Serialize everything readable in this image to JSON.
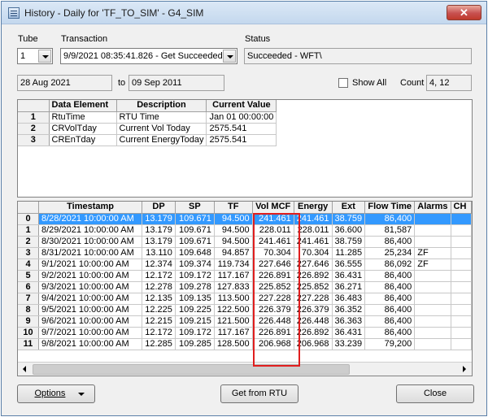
{
  "window": {
    "title": "History - Daily for 'TF_TO_SIM' - G4_SIM",
    "close_glyph": "✕"
  },
  "tube": {
    "label": "Tube",
    "value": "1"
  },
  "transaction": {
    "label": "Transaction",
    "value": "9/9/2021 08:35:41.826 - Get Succeeded"
  },
  "status": {
    "label": "Status",
    "value": "Succeeded - WFT\\"
  },
  "date_range": {
    "from": "28 Aug 2021",
    "to_label": "to",
    "to": "09 Sep 2011"
  },
  "show_all": {
    "label": "Show All",
    "checked": false
  },
  "count": {
    "label": "Count",
    "value": "4, 12"
  },
  "elements_table": {
    "headers": [
      "Data Element",
      "Description",
      "Current Value"
    ],
    "rows": [
      [
        "1",
        "RtuTime",
        "RTU Time",
        "Jan 01 00:00:00"
      ],
      [
        "2",
        "CRVolTday",
        "Current Vol Today",
        "2575.541"
      ],
      [
        "3",
        "CREnTday",
        "Current EnergyToday",
        "2575.541"
      ]
    ]
  },
  "history_table": {
    "headers": [
      "Timestamp",
      "DP",
      "SP",
      "TF",
      "Vol MCF",
      "Energy",
      "Ext",
      "Flow Time",
      "Alarms",
      "CH"
    ],
    "selected_row": 0,
    "rows": [
      [
        "0",
        "8/28/2021 10:00:00 AM",
        "13.179",
        "109.671",
        "94.500",
        "241.461",
        "241.461",
        "38.759",
        "86,400",
        "",
        ""
      ],
      [
        "1",
        "8/29/2021 10:00:00 AM",
        "13.179",
        "109.671",
        "94.500",
        "228.011",
        "228.011",
        "36.600",
        "81,587",
        "",
        ""
      ],
      [
        "2",
        "8/30/2021 10:00:00 AM",
        "13.179",
        "109.671",
        "94.500",
        "241.461",
        "241.461",
        "38.759",
        "86,400",
        "",
        ""
      ],
      [
        "3",
        "8/31/2021 10:00:00 AM",
        "13.110",
        "109.648",
        "94.857",
        "70.304",
        "70.304",
        "11.285",
        "25,234",
        "ZF",
        ""
      ],
      [
        "4",
        "9/1/2021 10:00:00 AM",
        "12.374",
        "109.374",
        "119.734",
        "227.646",
        "227.646",
        "36.555",
        "86,092",
        "ZF",
        ""
      ],
      [
        "5",
        "9/2/2021 10:00:00 AM",
        "12.172",
        "109.172",
        "117.167",
        "226.891",
        "226.892",
        "36.431",
        "86,400",
        "",
        ""
      ],
      [
        "6",
        "9/3/2021 10:00:00 AM",
        "12.278",
        "109.278",
        "127.833",
        "225.852",
        "225.852",
        "36.271",
        "86,400",
        "",
        ""
      ],
      [
        "7",
        "9/4/2021 10:00:00 AM",
        "12.135",
        "109.135",
        "113.500",
        "227.228",
        "227.228",
        "36.483",
        "86,400",
        "",
        ""
      ],
      [
        "8",
        "9/5/2021 10:00:00 AM",
        "12.225",
        "109.225",
        "122.500",
        "226.379",
        "226.379",
        "36.352",
        "86,400",
        "",
        ""
      ],
      [
        "9",
        "9/6/2021 10:00:00 AM",
        "12.215",
        "109.215",
        "121.500",
        "226.448",
        "226.448",
        "36.363",
        "86,400",
        "",
        ""
      ],
      [
        "10",
        "9/7/2021 10:00:00 AM",
        "12.172",
        "109.172",
        "117.167",
        "226.891",
        "226.892",
        "36.431",
        "86,400",
        "",
        ""
      ],
      [
        "11",
        "9/8/2021 10:00:00 AM",
        "12.285",
        "109.285",
        "128.500",
        "206.968",
        "206.968",
        "33.239",
        "79,200",
        "",
        ""
      ]
    ]
  },
  "buttons": {
    "options": "Options",
    "get_from_rtu": "Get from RTU",
    "close": "Close"
  },
  "colors": {
    "selection": "#3399ff",
    "highlight_box": "#e01e1e"
  }
}
